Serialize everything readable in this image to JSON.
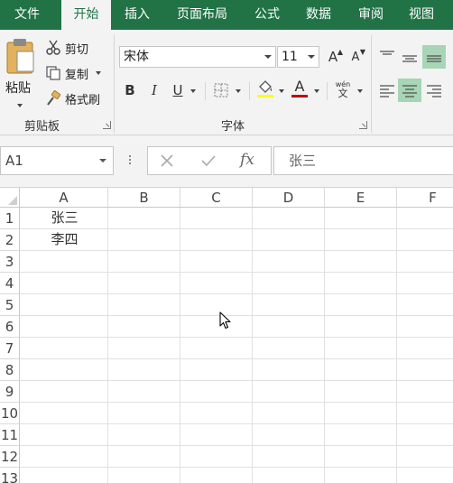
{
  "tabs": [
    {
      "label": "文件",
      "active": false
    },
    {
      "label": "开始",
      "active": true
    },
    {
      "label": "插入",
      "active": false
    },
    {
      "label": "页面布局",
      "active": false
    },
    {
      "label": "公式",
      "active": false
    },
    {
      "label": "数据",
      "active": false
    },
    {
      "label": "审阅",
      "active": false
    },
    {
      "label": "视图",
      "active": false
    }
  ],
  "clipboard": {
    "paste_label": "粘贴",
    "cut_label": "剪切",
    "copy_label": "复制",
    "format_painter_label": "格式刷",
    "group_label": "剪贴板"
  },
  "font": {
    "font_name": "宋体",
    "font_size": "11",
    "bold_label": "B",
    "italic_label": "I",
    "underline_label": "U",
    "font_color_label": "A",
    "grow_label": "A",
    "shrink_label": "A",
    "phonetic_top": "wén",
    "phonetic_bottom": "文",
    "group_label": "字体"
  },
  "formula_bar": {
    "name_box": "A1",
    "fx_label": "fx",
    "value": "张三"
  },
  "grid": {
    "columns": [
      "A",
      "B",
      "C",
      "D",
      "E",
      "F"
    ],
    "rows": [
      "1",
      "2",
      "3",
      "4",
      "5",
      "6",
      "7",
      "8",
      "9",
      "10",
      "11",
      "12",
      "13"
    ],
    "cells": {
      "A1": "张三",
      "A2": "李四"
    }
  },
  "colors": {
    "brand": "#217346",
    "font_color_bar": "#c00000",
    "align_selected": "#a8d5b5"
  }
}
